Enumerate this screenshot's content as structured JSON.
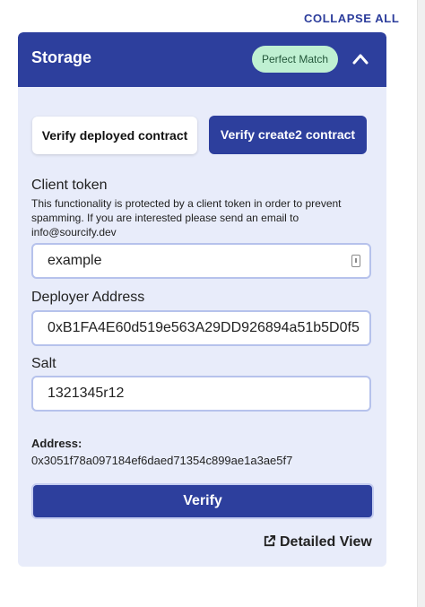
{
  "header": {
    "collapse_all": "COLLAPSE ALL"
  },
  "card": {
    "title": "Storage",
    "badge": "Perfect Match",
    "chevron_icon": "chevron-up-icon",
    "tabs": {
      "deployed": "Verify deployed contract",
      "create2": "Verify create2 contract"
    },
    "client_token": {
      "label": "Client token",
      "description": "This functionality is protected by a client token in order to prevent spamming. If you are interested please send an email to info@sourcify.dev",
      "value": "example"
    },
    "deployer": {
      "label": "Deployer Address",
      "value": "0xB1FA4E60d519e563A29DD926894a51b5D0f5"
    },
    "salt": {
      "label": "Salt",
      "value": "1321345r12"
    },
    "address": {
      "label": "Address:",
      "value": "0x3051f78a097184ef6daed71354c899ae1a3ae5f7"
    },
    "verify_button": "Verify",
    "detailed_view": "Detailed View"
  },
  "colors": {
    "primary": "#2d3f9d",
    "card_bg": "#e8ecfa",
    "badge_bg": "#bff0d2"
  }
}
